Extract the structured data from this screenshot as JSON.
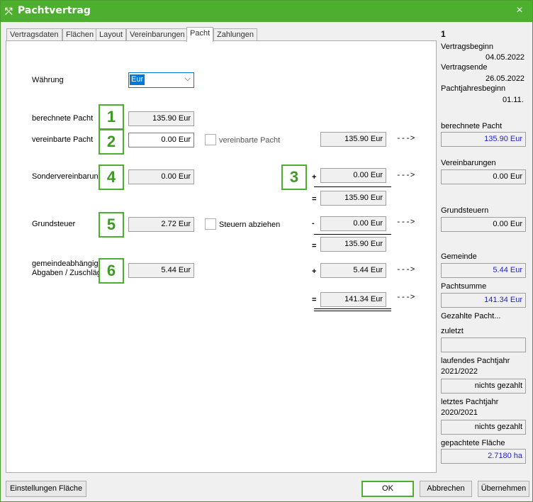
{
  "window": {
    "title": "Pachtvertrag",
    "close": "×"
  },
  "tabs": [
    "Vertragsdaten",
    "Flächen",
    "Layout",
    "Vereinbarungen",
    "Pacht",
    "Zahlungen"
  ],
  "form": {
    "waehrung_label": "Währung",
    "waehrung_value": "Eur",
    "berechnete_label": "berechnete Pacht",
    "berechnete_value": "135.90 Eur",
    "vereinbarte_label": "vereinbarte Pacht",
    "vereinbarte_value": "0.00 Eur",
    "vereinbarte_chk_label": "vereinbarte Pacht",
    "sonder_label": "Sondervereinbarungen",
    "sonder_value": "0.00 Eur",
    "grundsteuer_label": "Grundsteuer",
    "grundsteuer_value": "2.72 Eur",
    "steuern_chk_label": "Steuern abziehen",
    "gemeinde_label_1": "gemeindeabhängige",
    "gemeinde_label_2": "Abgaben / Zuschläge",
    "gemeinde_value": "5.44 Eur"
  },
  "calc": {
    "r1": "135.90 Eur",
    "plus_sonder": "0.00 Eur",
    "sum1": "135.90 Eur",
    "minus_steuer": "0.00 Eur",
    "sum2": "135.90 Eur",
    "plus_gemeinde": "5.44 Eur",
    "total": "141.34 Eur",
    "arrow": "--->",
    "plus": "+",
    "minus": "-",
    "equals": "="
  },
  "badges": [
    "1",
    "2",
    "3",
    "4",
    "5",
    "6"
  ],
  "side": {
    "number": "1",
    "vertragsbeginn_label": "Vertragsbeginn",
    "vertragsbeginn": "04.05.2022",
    "vertragsende_label": "Vertragsende",
    "vertragsende": "26.05.2022",
    "pachtjahresbeginn_label": "Pachtjahresbeginn",
    "pachtjahresbeginn": "01.11.",
    "berechnete_label": "berechnete Pacht",
    "berechnete": "135.90 Eur",
    "vereinbarungen_label": "Vereinbarungen",
    "vereinbarungen": "0.00 Eur",
    "grundsteuern_label": "Grundsteuern",
    "grundsteuern": "0.00 Eur",
    "gemeinde_label": "Gemeinde",
    "gemeinde": "5.44 Eur",
    "pachtsumme_label": "Pachtsumme",
    "pachtsumme": "141.34 Eur",
    "gezahlte_label": "Gezahlte Pacht...",
    "zuletzt_label": "zuletzt",
    "zuletzt": "",
    "laufendes_label": "laufendes Pachtjahr",
    "laufendes_year": "2021/2022",
    "laufendes": "nichts gezahlt",
    "letztes_label": "letztes Pachtjahr",
    "letztes_year": "2020/2021",
    "letztes": "nichts gezahlt",
    "flaeche_label": "gepachtete Fläche",
    "flaeche": "2.7180 ha"
  },
  "buttons": {
    "einstellungen": "Einstellungen Fläche",
    "ok": "OK",
    "abbrechen": "Abbrechen",
    "uebernehmen": "Übernehmen"
  }
}
